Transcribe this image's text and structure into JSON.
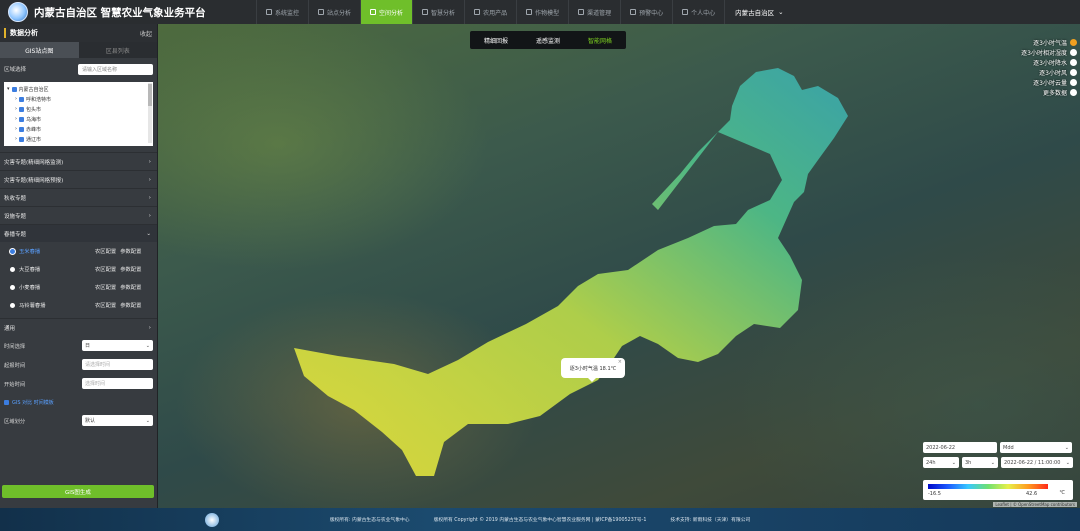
{
  "header": {
    "title": "内蒙古自治区 智慧农业气象业务平台",
    "logo_alt": "",
    "nav": [
      {
        "label": "系统监控",
        "icon": "monitor-icon",
        "active": false
      },
      {
        "label": "站点分析",
        "icon": "location-icon",
        "active": false
      },
      {
        "label": "空间分析",
        "icon": "map-icon",
        "active": true
      },
      {
        "label": "智慧分析",
        "icon": "chart-icon",
        "active": false
      },
      {
        "label": "农用产品",
        "icon": "product-icon",
        "active": false
      },
      {
        "label": "作物模型",
        "icon": "model-icon",
        "active": false
      },
      {
        "label": "渠道管理",
        "icon": "channel-icon",
        "active": false
      },
      {
        "label": "预警中心",
        "icon": "warning-icon",
        "active": false
      },
      {
        "label": "个人中心",
        "icon": "user-icon",
        "active": false
      }
    ],
    "region": "内蒙古自治区"
  },
  "sidebar": {
    "title": "数据分析",
    "collapse": "收起",
    "tabs": [
      "GIS站点图",
      "区县列表"
    ],
    "region_label": "区域选择",
    "region_placeholder": "请输入区域名称",
    "tree": [
      "内蒙古自治区",
      "呼和浩特市",
      "包头市",
      "乌海市",
      "赤峰市",
      "通辽市"
    ],
    "sections": [
      "灾害专题(精细网格监测)",
      "灾害专题(精细网格预报)",
      "秋收专题",
      "设施专题",
      "春播专题"
    ],
    "crops": [
      {
        "name": "玉米春播",
        "selected": true
      },
      {
        "name": "大豆春播",
        "selected": false
      },
      {
        "name": "小麦春播",
        "selected": false
      },
      {
        "name": "马铃薯春播",
        "selected": false
      }
    ],
    "crop_actions": [
      "农区配置",
      "参数配置"
    ],
    "general": "通用",
    "form": {
      "time_label": "时间选择",
      "time_value": "日",
      "start_label": "起报时间",
      "start_placeholder": "请选择时间",
      "ref_label": "开始时间",
      "ref_placeholder": "选择时间",
      "link": "GIS 对比 时间模板",
      "area_label": "区域划分",
      "area_value": "默认"
    },
    "generate": "GIS图生成"
  },
  "map": {
    "modes": [
      "精细回报",
      "遥感监测",
      "智能网格"
    ],
    "active_mode": "智能网格",
    "layers": [
      {
        "label": "逐3小时气温",
        "icon": "thermometer-icon",
        "active": true
      },
      {
        "label": "逐3小时相对湿度",
        "icon": "humidity-icon",
        "active": false
      },
      {
        "label": "逐3小时降水",
        "icon": "rain-icon",
        "active": false
      },
      {
        "label": "逐3小时风",
        "icon": "wind-icon",
        "active": false
      },
      {
        "label": "逐3小时云量",
        "icon": "cloud-icon",
        "active": false
      },
      {
        "label": "更多数据",
        "icon": "more-icon",
        "active": false
      }
    ],
    "popup": "逐3小时气温 18.1℃",
    "date": "2022-06-22",
    "element": "Mdd",
    "range": "24h",
    "step": "3h",
    "datetime": "2022-06-22 / 11:00:00",
    "legend_min": "-16.5",
    "legend_max": "42.6",
    "legend_unit": "℃",
    "attribution": "Leaflet | © OpenStreetMap contributors"
  },
  "footer": {
    "host": "版权所有: 内蒙古生态与农业气象中心",
    "copyright": "版权所有 Copyright © 2019 内蒙古生态与农业气象中心智慧农业服务网 | 蒙ICP备19005237号-1",
    "support": "技术支持: 新雨科技（天津）有限公司"
  },
  "colors": {
    "accent": "#6fbf2a",
    "nav_bg": "#2a2d30",
    "sidebar_bg": "#373b40"
  }
}
